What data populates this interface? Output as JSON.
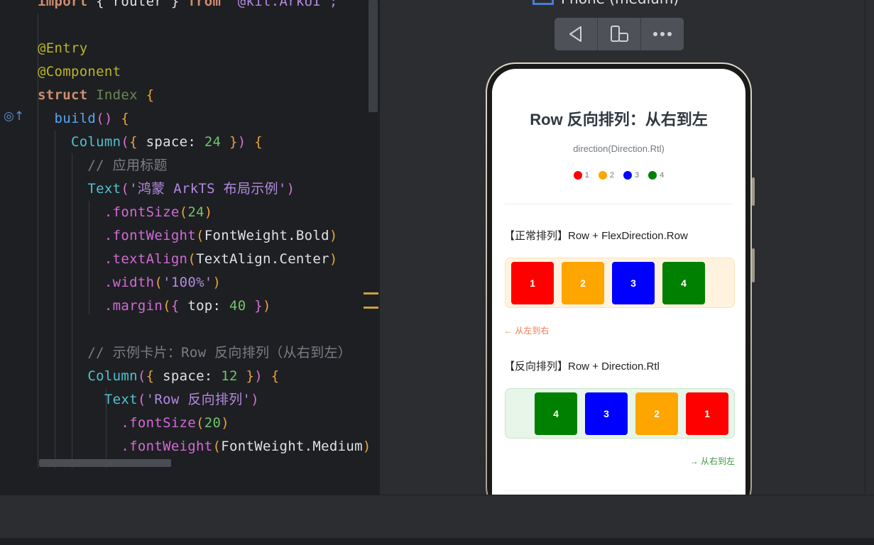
{
  "editor": {
    "lines": [
      [
        {
          "t": "import",
          "c": "tok-kw"
        },
        {
          "t": " { ",
          "c": "tok-text"
        },
        {
          "t": "router",
          "c": "tok-text"
        },
        {
          "t": " } ",
          "c": "tok-text"
        },
        {
          "t": "from",
          "c": "tok-kw"
        },
        {
          "t": " '@kit.ArkUI';",
          "c": "tok-str"
        }
      ],
      [],
      [
        {
          "t": "@Entry",
          "c": "tok-ann"
        }
      ],
      [
        {
          "t": "@Component",
          "c": "tok-ann"
        }
      ],
      [
        {
          "t": "struct ",
          "c": "tok-kw"
        },
        {
          "t": "Index ",
          "c": "tok-type"
        },
        {
          "t": "{",
          "c": "tok-brace"
        }
      ],
      [
        {
          "t": "  build",
          "c": "tok-fn"
        },
        {
          "t": "() ",
          "c": "tok-brace2"
        },
        {
          "t": "{",
          "c": "tok-brace"
        }
      ],
      [
        {
          "t": "    Column",
          "c": "tok-comp"
        },
        {
          "t": "(",
          "c": "tok-brace2"
        },
        {
          "t": "{ ",
          "c": "tok-brace"
        },
        {
          "t": "space: ",
          "c": "tok-text"
        },
        {
          "t": "24",
          "c": "tok-num"
        },
        {
          "t": " }",
          "c": "tok-brace"
        },
        {
          "t": ") ",
          "c": "tok-brace2"
        },
        {
          "t": "{",
          "c": "tok-brace"
        }
      ],
      [
        {
          "t": "      // 应用标题",
          "c": "tok-cmt"
        }
      ],
      [
        {
          "t": "      Text",
          "c": "tok-comp"
        },
        {
          "t": "(",
          "c": "tok-brace2"
        },
        {
          "t": "'鸿蒙 ArkTS 布局示例'",
          "c": "tok-str"
        },
        {
          "t": ")",
          "c": "tok-brace2"
        }
      ],
      [
        {
          "t": "        .fontSize",
          "c": "tok-method"
        },
        {
          "t": "(",
          "c": "tok-brace"
        },
        {
          "t": "24",
          "c": "tok-num"
        },
        {
          "t": ")",
          "c": "tok-brace"
        }
      ],
      [
        {
          "t": "        .fontWeight",
          "c": "tok-method"
        },
        {
          "t": "(",
          "c": "tok-brace"
        },
        {
          "t": "FontWeight.Bold",
          "c": "tok-text"
        },
        {
          "t": ")",
          "c": "tok-brace"
        }
      ],
      [
        {
          "t": "        .textAlign",
          "c": "tok-method"
        },
        {
          "t": "(",
          "c": "tok-brace"
        },
        {
          "t": "TextAlign.Center",
          "c": "tok-text"
        },
        {
          "t": ")",
          "c": "tok-brace"
        }
      ],
      [
        {
          "t": "        .width",
          "c": "tok-method"
        },
        {
          "t": "(",
          "c": "tok-brace"
        },
        {
          "t": "'100%'",
          "c": "tok-str"
        },
        {
          "t": ")",
          "c": "tok-brace"
        }
      ],
      [
        {
          "t": "        .margin",
          "c": "tok-method"
        },
        {
          "t": "(",
          "c": "tok-brace"
        },
        {
          "t": "{ ",
          "c": "tok-brace2"
        },
        {
          "t": "top: ",
          "c": "tok-text"
        },
        {
          "t": "40",
          "c": "tok-num"
        },
        {
          "t": " }",
          "c": "tok-brace2"
        },
        {
          "t": ")",
          "c": "tok-brace"
        }
      ],
      [],
      [
        {
          "t": "      // 示例卡片：Row 反向排列（从右到左）",
          "c": "tok-cmt"
        }
      ],
      [
        {
          "t": "      Column",
          "c": "tok-comp"
        },
        {
          "t": "(",
          "c": "tok-brace2"
        },
        {
          "t": "{ ",
          "c": "tok-brace"
        },
        {
          "t": "space: ",
          "c": "tok-text"
        },
        {
          "t": "12",
          "c": "tok-num"
        },
        {
          "t": " }",
          "c": "tok-brace"
        },
        {
          "t": ") ",
          "c": "tok-brace2"
        },
        {
          "t": "{",
          "c": "tok-brace"
        }
      ],
      [
        {
          "t": "        Text",
          "c": "tok-comp"
        },
        {
          "t": "(",
          "c": "tok-brace2"
        },
        {
          "t": "'Row 反向排列'",
          "c": "tok-str"
        },
        {
          "t": ")",
          "c": "tok-brace2"
        }
      ],
      [
        {
          "t": "          .fontSize",
          "c": "tok-method"
        },
        {
          "t": "(",
          "c": "tok-brace"
        },
        {
          "t": "20",
          "c": "tok-num"
        },
        {
          "t": ")",
          "c": "tok-brace"
        }
      ],
      [
        {
          "t": "          .fontWeight",
          "c": "tok-method"
        },
        {
          "t": "(",
          "c": "tok-brace"
        },
        {
          "t": "FontWeight.Medium",
          "c": "tok-text"
        },
        {
          "t": ")",
          "c": "tok-brace"
        }
      ]
    ]
  },
  "preview": {
    "device_label": "Phone (medium)",
    "toolbar": {
      "back_icon": "back-triangle-icon",
      "rotate_icon": "rotate-device-icon",
      "more_icon": "more-icon"
    },
    "screen": {
      "title": "Row 反向排列：从右到左",
      "subtitle": "direction(Direction.Rtl)",
      "legend": [
        {
          "label": "1",
          "color": "#ff0000"
        },
        {
          "label": "2",
          "color": "#ffa500"
        },
        {
          "label": "3",
          "color": "#0000ff"
        },
        {
          "label": "4",
          "color": "#008000"
        }
      ],
      "normal_title": "【正常排列】Row + FlexDirection.Row",
      "normal_blocks": [
        "1",
        "2",
        "3",
        "4"
      ],
      "normal_hint": "← 从左到右",
      "reverse_title": "【反向排列】Row + Direction.Rtl",
      "reverse_blocks": [
        "4",
        "3",
        "2",
        "1"
      ],
      "reverse_hint": "→ 从右到左",
      "colors": {
        "normal_bg": "#fff3e0",
        "normal_border": "#ffe0b2",
        "reverse_bg": "#e8f5e9",
        "reverse_border": "#c8e6c9",
        "normal_hint": "#f57c4c",
        "reverse_hint": "#3c9a3c"
      }
    }
  }
}
